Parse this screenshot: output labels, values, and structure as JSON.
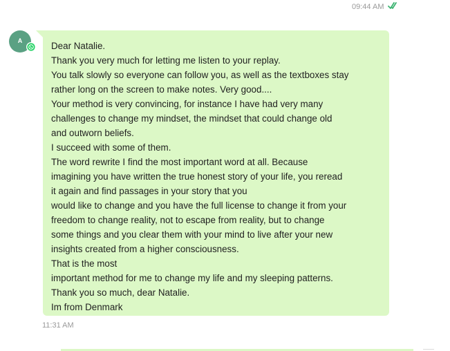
{
  "previous_message": {
    "timestamp": "09:44 AM",
    "status_icon": "double-check-icon",
    "status_color": "#3cb371"
  },
  "message": {
    "sender_avatar_initial": "A",
    "avatar_color": "#5aa183",
    "badge_icon": "whatsapp-icon",
    "bubble_color": "#dcf8c6",
    "lines": [
      "Dear Natalie.",
      "Thank you very much for letting me listen to your replay.",
      "You talk slowly so everyone can follow you, as well as the textboxes stay",
      "rather long on the screen to make notes. Very good....",
      "Your method is very convincing,  for instance I have had very many",
      "challenges to change my mindset, the mindset that could change old",
      "and outworn beliefs.",
      "I succeed with some of them.",
      "The word rewrite I find the most important word at all. Because",
      "imagining you have written the true honest story of your life, you reread",
      "it again and find passages in your story that you",
      "would like to change and you have the full license to change it from your",
      "freedom to change reality, not to escape from reality, but to change",
      "some things and you clear them with your mind to live after your new",
      "insights created from a higher consciousness.",
      "That is the most",
      "important method for me to change my life and my sleeping patterns.",
      "Thank you so much, dear Natalie.",
      "Im from Denmark"
    ],
    "timestamp": "11:31 AM"
  }
}
